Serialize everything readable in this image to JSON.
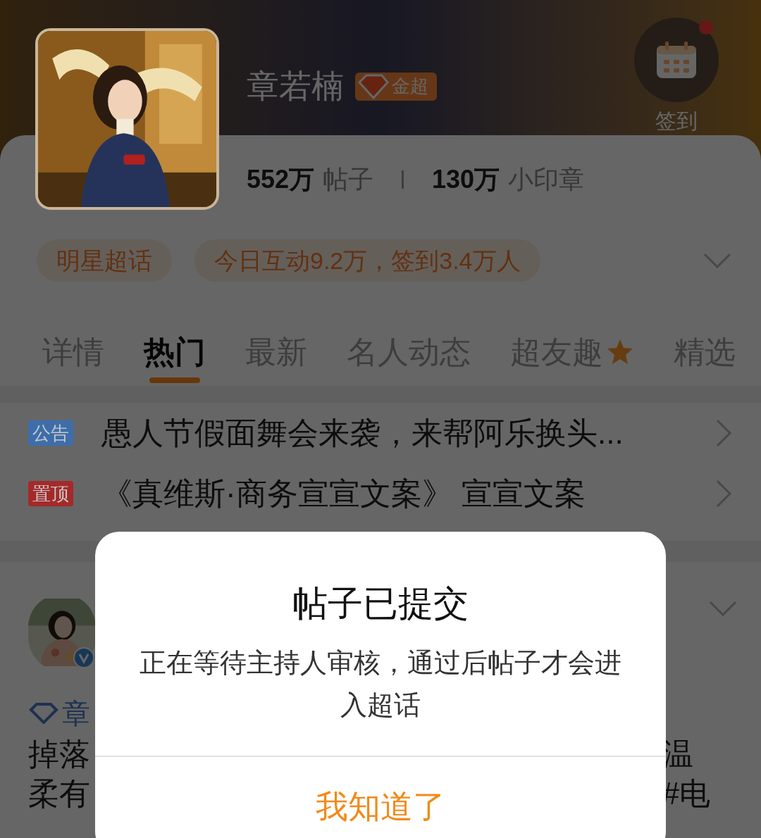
{
  "header": {
    "name": "章若楠",
    "badge": "金超",
    "checkin": {
      "label": "签到",
      "unread": true
    }
  },
  "stats": [
    {
      "value": "552万",
      "label": "帖子"
    },
    {
      "value": "130万",
      "label": "小印章"
    }
  ],
  "chips": [
    "明星超话",
    "今日互动9.2万，签到3.4万人"
  ],
  "tabs": [
    {
      "label": "详情",
      "selected": false,
      "star": false
    },
    {
      "label": "热门",
      "selected": true,
      "star": false
    },
    {
      "label": "最新",
      "selected": false,
      "star": false
    },
    {
      "label": "名人动态",
      "selected": false,
      "star": false
    },
    {
      "label": "超友趣",
      "selected": false,
      "star": true
    },
    {
      "label": "精选",
      "selected": false,
      "star": false
    }
  ],
  "notices": [
    {
      "tag": "公告",
      "color": "#3d6eab",
      "text": "愚人节假面舞会来袭，来帮阿乐换头..."
    },
    {
      "tag": "置顶",
      "color": "#a42a2a",
      "text": "《真维斯·商务宣宣文案》 宣宣文案"
    }
  ],
  "post": {
    "author": "章",
    "left_lines": [
      "掉落",
      "柔有"
    ],
    "right_lines": [
      "温",
      "#电"
    ]
  },
  "dialog": {
    "title": "帖子已提交",
    "message": "正在等待主持人审核，通过后帖子才会进入超话",
    "button": "我知道了"
  }
}
